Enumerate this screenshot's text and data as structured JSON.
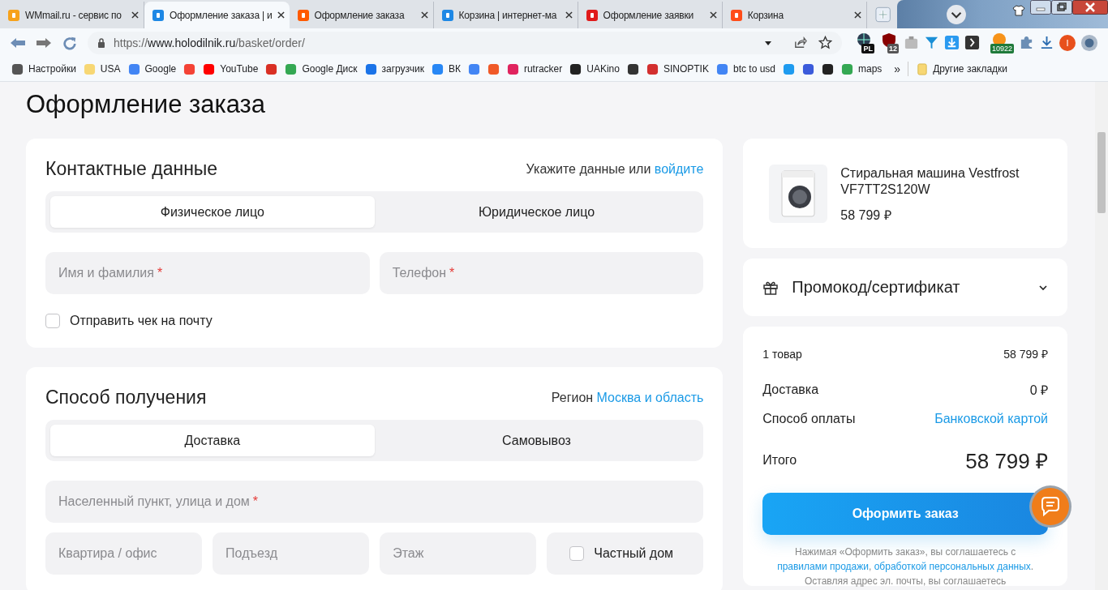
{
  "browser": {
    "tabs": [
      {
        "title": "WMmail.ru - сервис по",
        "selected": false
      },
      {
        "title": "Оформление заказа | и",
        "selected": true
      },
      {
        "title": "Оформление заказа",
        "selected": false
      },
      {
        "title": "Корзина | интернет-ма",
        "selected": false
      },
      {
        "title": "Оформление заявки",
        "selected": false
      },
      {
        "title": "Корзина",
        "selected": false
      }
    ],
    "url": {
      "scheme": "https://",
      "host": "www.holodilnik.ru",
      "path": "/basket/order/"
    },
    "extensions": [
      {
        "badge": "PL"
      },
      {
        "badge": "12"
      },
      {
        "badge": "10922"
      }
    ],
    "profile_initial": "I",
    "bookmarks": [
      {
        "kind": "link",
        "label": "Настройки"
      },
      {
        "kind": "link",
        "label": "USA"
      },
      {
        "kind": "link",
        "label": "Google"
      },
      {
        "kind": "icon"
      },
      {
        "kind": "link",
        "label": "YouTube"
      },
      {
        "kind": "icon"
      },
      {
        "kind": "link",
        "label": "Google Диск"
      },
      {
        "kind": "link",
        "label": "загрузчик"
      },
      {
        "kind": "link",
        "label": "ВК"
      },
      {
        "kind": "icon"
      },
      {
        "kind": "icon"
      },
      {
        "kind": "link",
        "label": "rutracker"
      },
      {
        "kind": "link",
        "label": "UAKino"
      },
      {
        "kind": "icon"
      },
      {
        "kind": "link",
        "label": "SINOPTIK"
      },
      {
        "kind": "link",
        "label": "btc to usd"
      },
      {
        "kind": "icon"
      },
      {
        "kind": "icon"
      },
      {
        "kind": "icon"
      },
      {
        "kind": "link",
        "label": "maps"
      }
    ],
    "more": "»",
    "other_bookmarks": "Другие закладки"
  },
  "page": {
    "title": "Оформление заказа",
    "contact": {
      "title": "Контактные данные",
      "hint": "Укажите данные или",
      "login_link": "войдите",
      "segments": [
        {
          "label": "Физическое лицо",
          "selected": true
        },
        {
          "label": "Юридическое лицо",
          "selected": false
        }
      ],
      "fields": [
        {
          "placeholder": "Имя и фамилия",
          "mark": "*"
        },
        {
          "placeholder": "Телефон",
          "mark": "*"
        }
      ],
      "checkbox": {
        "label": "Отправить чек на почту",
        "checked": false
      }
    },
    "delivery": {
      "title": "Способ получения",
      "region_label": "Регион",
      "region_link": "Москва и область",
      "segments": [
        {
          "label": "Доставка",
          "selected": true
        },
        {
          "label": "Самовывоз",
          "selected": false
        }
      ],
      "address": {
        "placeholder": "Населенный пункт, улица и дом",
        "mark": "*"
      },
      "fields": [
        {
          "placeholder": "Квартира / офис"
        },
        {
          "placeholder": "Подъезд"
        },
        {
          "placeholder": "Этаж"
        }
      ],
      "checkbox": {
        "label": "Частный дом",
        "checked": false
      }
    },
    "product": {
      "name": "Стиральная машина Vestfrost VF7TT2S120W",
      "price": "58 799 ₽"
    },
    "promo": {
      "label": "Промокод/сертификат",
      "expanded": false
    },
    "summary": [
      {
        "label": "1 товар",
        "value": "58 799 ₽",
        "kind": "small"
      },
      {
        "label": "Доставка",
        "value": "0 ₽",
        "kind": "plain"
      },
      {
        "label": "Способ оплаты",
        "value": "Банковской картой",
        "kind": "link"
      }
    ],
    "total": {
      "label": "Итого",
      "value": "58 799 ₽"
    },
    "order_button": "Оформить заказ",
    "legal": {
      "before": "Нажимая «Оформить заказ», вы соглашаетесь с",
      "links": [
        "правилами продажи",
        "обработкой персональных данных"
      ],
      "separator": ",",
      "after": ".",
      "line_2": "Оставляя адрес эл. почты, вы соглашаетесь"
    }
  }
}
